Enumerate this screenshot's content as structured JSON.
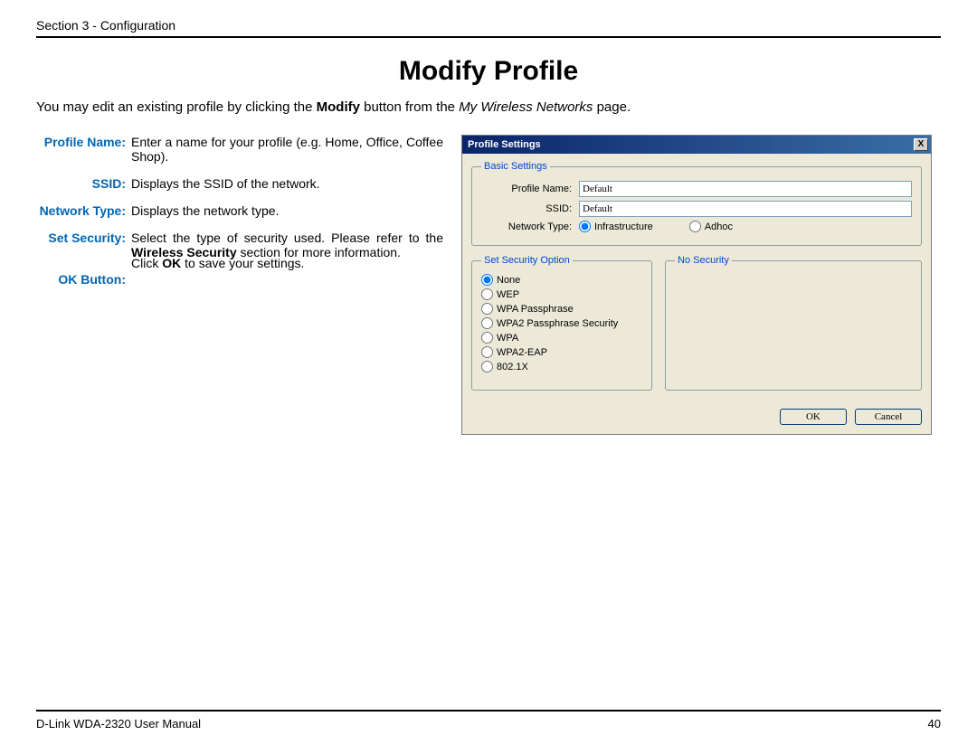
{
  "header": {
    "section": "Section 3 - Configuration"
  },
  "title": "Modify Profile",
  "intro": {
    "prefix": "You may edit an existing profile by clicking the ",
    "bold1": "Modify",
    "mid": " button from the ",
    "italic": "My Wireless Networks",
    "suffix": " page."
  },
  "definitions": {
    "profileName": {
      "label": "Profile Name:",
      "text": "Enter a name for your profile (e.g. Home, Office, Coffee Shop)."
    },
    "ssid": {
      "label": "SSID:",
      "text": "Displays the SSID of the network."
    },
    "networkType": {
      "label": "Network Type:",
      "text": "Displays the network type."
    },
    "setSecurity": {
      "label": "Set Security:",
      "prefix": "Select the type of security used. Please refer to the ",
      "bold": "Wireless Security",
      "suffix": " section for more information."
    },
    "okButton": {
      "label": "OK Button:",
      "prefix": "Click ",
      "bold": "OK",
      "suffix": " to save your settings."
    }
  },
  "dialog": {
    "title": "Profile Settings",
    "close": "X",
    "basic": {
      "legend": "Basic Settings",
      "profileNameLabel": "Profile Name:",
      "profileNameValue": "Default",
      "ssidLabel": "SSID:",
      "ssidValue": "Default",
      "networkTypeLabel": "Network Type:",
      "infrastructure": "Infrastructure",
      "adhoc": "Adhoc"
    },
    "security": {
      "legend": "Set Security Option",
      "options": {
        "none": "None",
        "wep": "WEP",
        "wpaPass": "WPA Passphrase",
        "wpa2Pass": "WPA2 Passphrase Security",
        "wpa": "WPA",
        "wpa2eap": "WPA2-EAP",
        "x8021": "802.1X"
      }
    },
    "noSecurity": {
      "legend": "No Security"
    },
    "buttons": {
      "ok": "OK",
      "cancel": "Cancel"
    }
  },
  "footer": {
    "manual": "D-Link WDA-2320 User Manual",
    "page": "40"
  }
}
